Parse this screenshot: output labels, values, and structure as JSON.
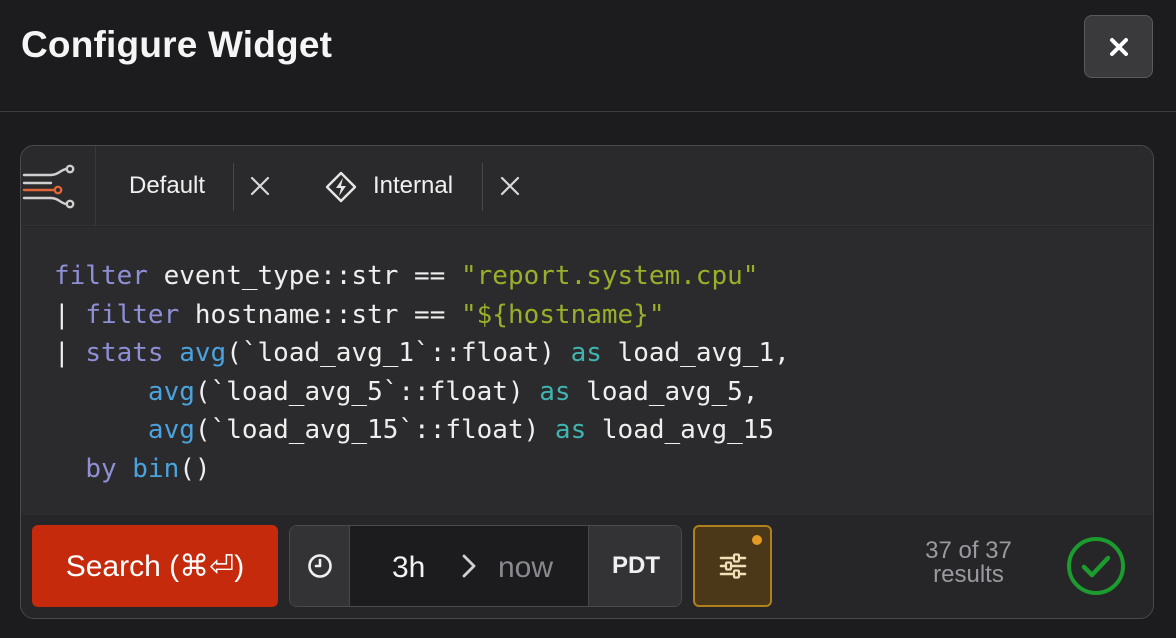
{
  "dialog": {
    "title": "Configure Widget"
  },
  "tabs": [
    {
      "label": "Default",
      "icon": "database-icon"
    },
    {
      "label": "Internal",
      "icon": "bolt-icon"
    }
  ],
  "query": {
    "lines": [
      "filter event_type::str == \"report.system.cpu\"",
      "| filter hostname::str == \"${hostname}\"",
      "| stats avg(`load_avg_1`::float) as load_avg_1,",
      "      avg(`load_avg_5`::float) as load_avg_5,",
      "      avg(`load_avg_15`::float) as load_avg_15",
      "  by bin()"
    ]
  },
  "toolbar": {
    "search_label": "Search (⌘⏎)",
    "time_start": "3h",
    "time_end": "now",
    "timezone": "PDT",
    "results_count": "37 of 37",
    "results_label": "results"
  },
  "colors": {
    "search_button": "#c52a0c",
    "filter_accent": "#b07f1e",
    "status_ok": "#1c9b2e"
  }
}
